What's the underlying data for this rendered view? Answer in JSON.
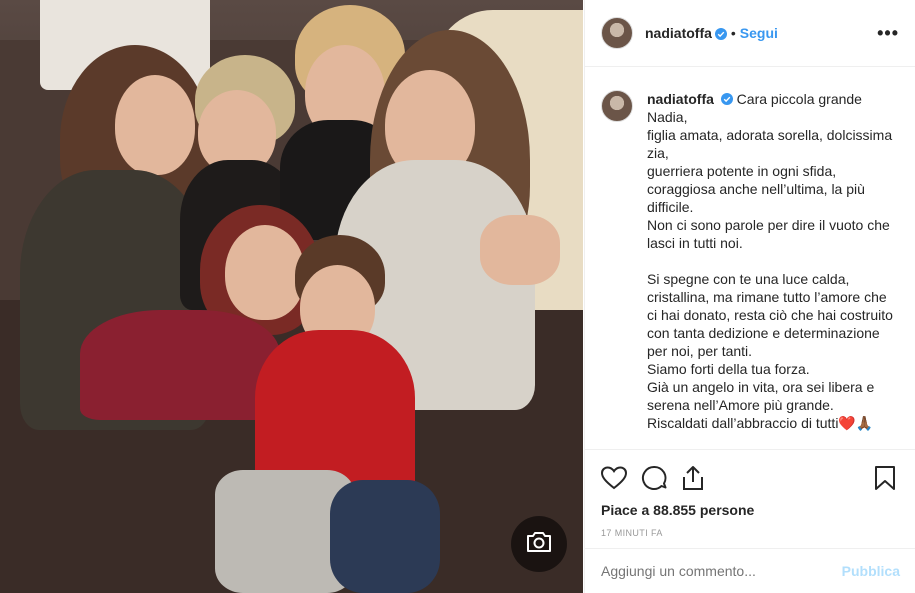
{
  "post": {
    "username": "nadiatoffa",
    "follow_label": "Segui",
    "more_label": "•••",
    "separator": "•"
  },
  "caption": {
    "username": "nadiatoffa",
    "lines": [
      "Cara piccola grande Nadia,",
      "figlia amata, adorata sorella, dolcissima zia,",
      "guerriera potente in ogni sfida, coraggiosa anche nell’ultima, la più difficile.",
      "Non ci sono parole per dire il vuoto che lasci in tutti noi.",
      "",
      "Si spegne con te una luce calda, cristallina, ma rimane tutto l’amore che ci hai donato, resta ciò che hai costruito con tanta dedizione e determinazione per noi, per tanti.",
      "Siamo forti della tua forza.",
      "Già un angelo in vita, ora sei libera e serena nell’Amore più grande.",
      "Riscaldati dall’abbraccio di tutti❤️🙏🏾"
    ]
  },
  "stats": {
    "likes": "Piace a 88.855 persone",
    "time": "17 MINUTI FA"
  },
  "comment": {
    "placeholder": "Aggiungi un commento...",
    "publish_label": "Pubblica"
  },
  "icons": {
    "verified": "verified-badge-icon",
    "like": "heart-icon",
    "comment": "comment-bubble-icon",
    "share": "share-icon",
    "save": "bookmark-icon",
    "camera": "camera-icon"
  },
  "colors": {
    "link_blue": "#3897f0",
    "publish_disabled": "#b2dffc",
    "verified": "#3897f0"
  }
}
